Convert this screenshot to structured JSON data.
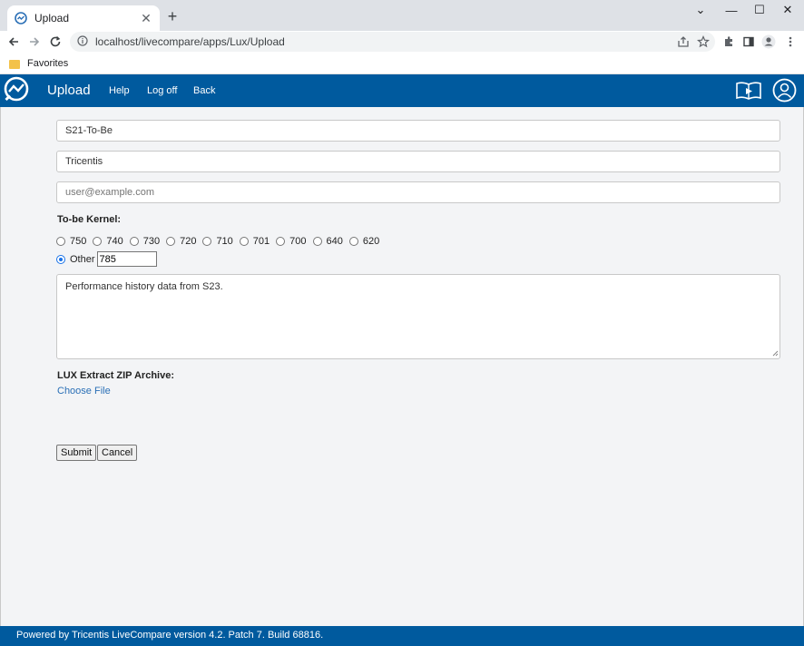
{
  "browser": {
    "tab_title": "Upload",
    "new_tab_glyph": "+",
    "url": "localhost/livecompare/apps/Lux/Upload",
    "bookmarks": [
      {
        "label": "Favorites"
      }
    ]
  },
  "header": {
    "title": "Upload",
    "nav": [
      {
        "label": "Help"
      },
      {
        "label": "Log off"
      },
      {
        "label": "Back"
      }
    ]
  },
  "form": {
    "name_value": "S21-To-Be",
    "company_value": "Tricentis",
    "email_placeholder": "user@example.com",
    "kernel_label": "To-be Kernel:",
    "kernel_options": [
      "750",
      "740",
      "730",
      "720",
      "710",
      "701",
      "700",
      "640",
      "620"
    ],
    "other_label": "Other",
    "other_value": "785",
    "selected_kernel": "Other",
    "description": "Performance history data from S23.",
    "zip_label": "LUX Extract ZIP Archive:",
    "choose_file_label": "Choose File",
    "submit_label": "Submit",
    "cancel_label": "Cancel"
  },
  "footer": {
    "text": "Powered by Tricentis LiveCompare version 4.2. Patch 7. Build 68816."
  },
  "colors": {
    "brand_blue": "#005a9e",
    "link_blue": "#2a6fb6",
    "page_bg": "#f3f4f6"
  },
  "icons": [
    "livecompare-logo-icon",
    "close-icon",
    "back-arrow-icon",
    "forward-arrow-icon",
    "reload-icon",
    "info-icon",
    "share-icon",
    "star-icon",
    "extensions-icon",
    "side-panel-icon",
    "profile-icon",
    "more-menu-icon",
    "folder-icon",
    "book-video-icon",
    "user-account-icon"
  ]
}
